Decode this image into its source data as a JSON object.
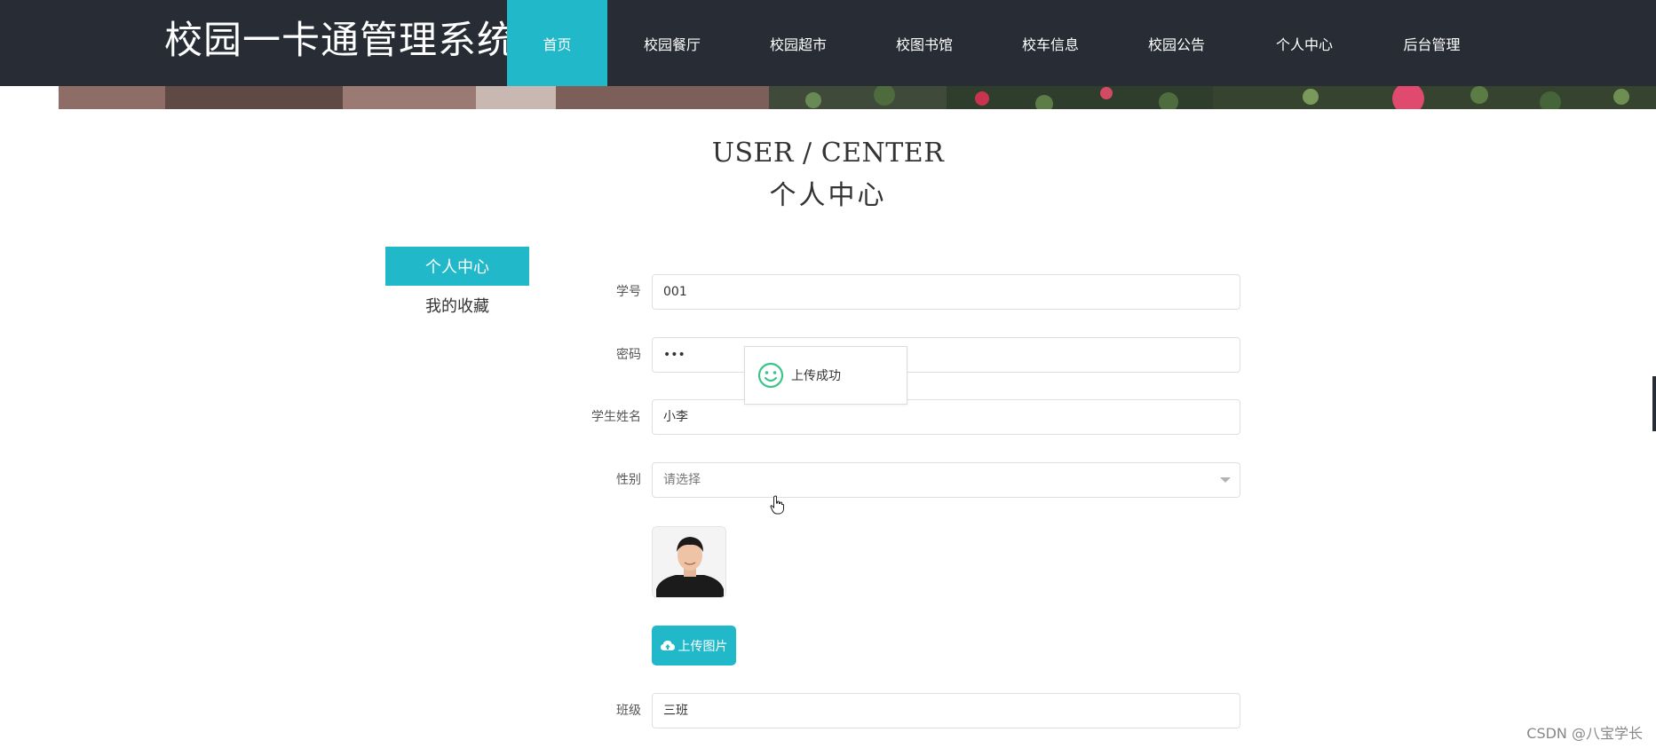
{
  "header": {
    "title": "校园一卡通管理系统",
    "nav": [
      {
        "label": "首页",
        "active": true
      },
      {
        "label": "校园餐厅",
        "active": false
      },
      {
        "label": "校园超市",
        "active": false
      },
      {
        "label": "校图书馆",
        "active": false
      },
      {
        "label": "校车信息",
        "active": false
      },
      {
        "label": "校园公告",
        "active": false
      },
      {
        "label": "个人中心",
        "active": false
      },
      {
        "label": "后台管理",
        "active": false
      }
    ],
    "colors": {
      "bar": "#272c35",
      "accent": "#21b8c9"
    }
  },
  "section": {
    "title_en": "USER / CENTER",
    "title_cn": "个人中心"
  },
  "side_menu": {
    "items": [
      {
        "label": "个人中心",
        "active": true
      },
      {
        "label": "我的收藏",
        "active": false
      }
    ]
  },
  "form": {
    "student_id": {
      "label": "学号",
      "value": "001"
    },
    "password": {
      "label": "密码",
      "value": "•••"
    },
    "student_name": {
      "label": "学生姓名",
      "value": "小李"
    },
    "gender": {
      "label": "性别",
      "placeholder": "请选择"
    },
    "avatar": {
      "icon": "user-photo"
    },
    "upload_button": {
      "label": "上传图片",
      "icon": "cloud-upload-icon"
    },
    "class": {
      "label": "班级",
      "value": "三班"
    }
  },
  "toast": {
    "text": "上传成功",
    "icon": "smile-icon"
  },
  "watermark": "CSDN @八宝学长"
}
